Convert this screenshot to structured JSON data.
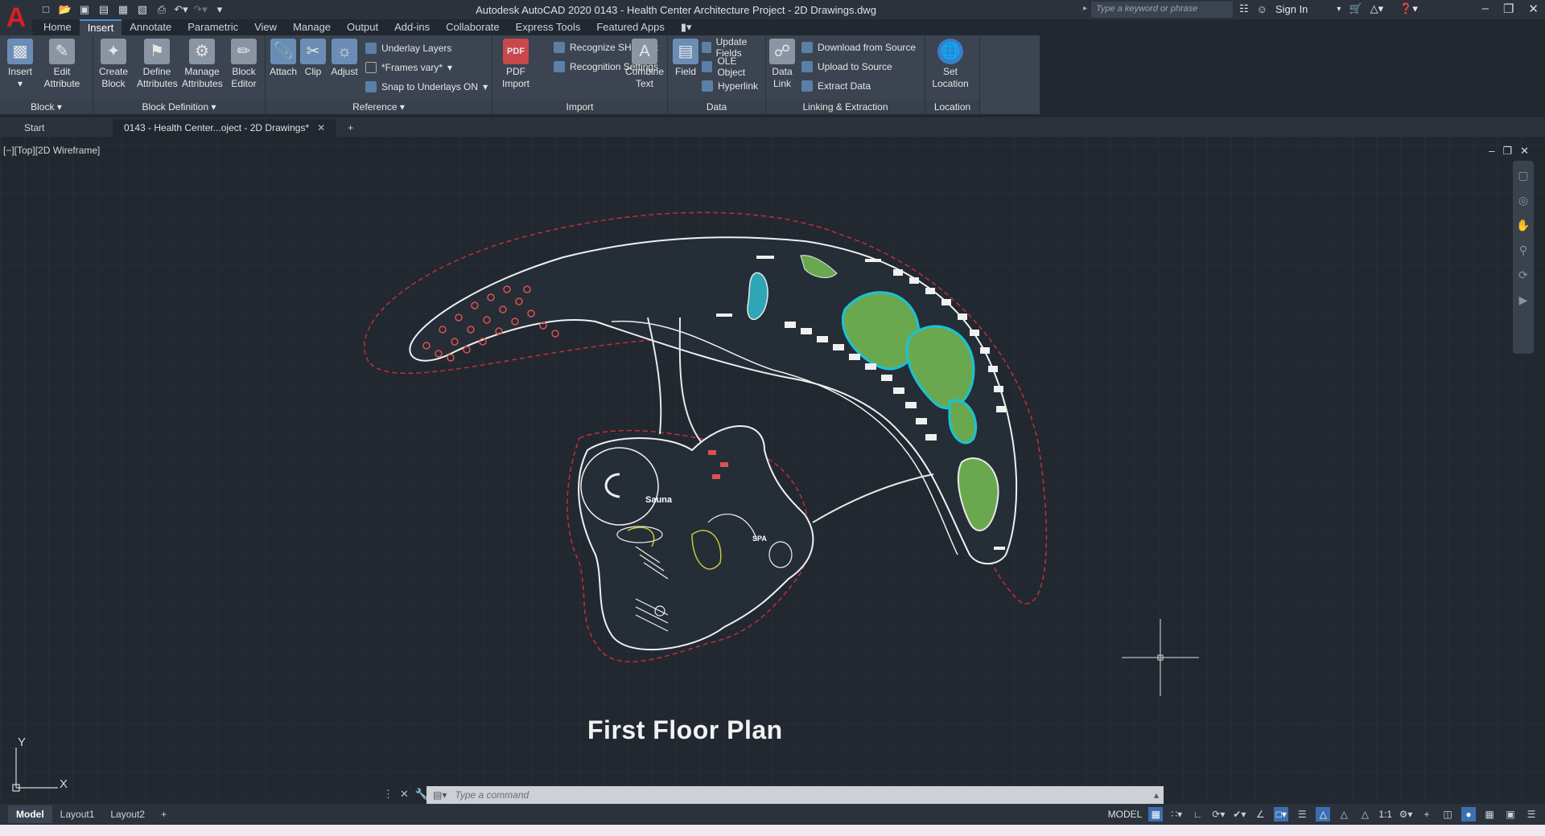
{
  "app": {
    "logo": "A",
    "title": "Autodesk AutoCAD 2020    0143 - Health Center Architecture Project - 2D Drawings.dwg"
  },
  "quick_access": [
    "new-icon",
    "open-icon",
    "save-icon",
    "save-as-icon",
    "web-mobile-open-icon",
    "web-mobile-save-icon",
    "plot-icon",
    "undo-icon",
    "redo-icon",
    "customize-icon"
  ],
  "search": {
    "placeholder": "Type a keyword or phrase"
  },
  "account": {
    "sign_in": "Sign In"
  },
  "ribbon_tabs": [
    "Home",
    "Insert",
    "Annotate",
    "Parametric",
    "View",
    "Manage",
    "Output",
    "Add-ins",
    "Collaborate",
    "Express Tools",
    "Featured Apps"
  ],
  "ribbon_active_tab": "Insert",
  "panels": {
    "block": {
      "title": "Block",
      "insert": "Insert",
      "edit_attribute": "Edit Attribute"
    },
    "block_definition": {
      "title": "Block Definition",
      "create_block": "Create Block",
      "define_attributes": "Define Attributes",
      "manage_attributes": "Manage Attributes",
      "block_editor": "Block Editor"
    },
    "reference": {
      "title": "Reference",
      "attach": "Attach",
      "clip": "Clip",
      "adjust": "Adjust",
      "underlay_layers": "Underlay Layers",
      "frames_vary": "*Frames vary*",
      "snap_to_underlays": "Snap to Underlays ON"
    },
    "import": {
      "title": "Import",
      "pdf_import": "PDF Import",
      "recognize_shx": "Recognize SHX Text",
      "recognition_settings": "Recognition Settings",
      "combine_text": "Combine Text"
    },
    "data": {
      "title": "Data",
      "field": "Field",
      "update_fields": "Update Fields",
      "ole_object": "OLE Object",
      "hyperlink": "Hyperlink"
    },
    "linking": {
      "title": "Linking & Extraction",
      "data_link": "Data Link",
      "download_source": "Download from Source",
      "upload_source": "Upload to Source",
      "extract_data": "Extract  Data"
    },
    "location": {
      "title": "Location",
      "set_location": "Set Location"
    }
  },
  "doc_tabs": [
    "Start",
    "0143 - Health Center...oject - 2D Drawings*"
  ],
  "viewport_label": "[−][Top][2D Wireframe]",
  "drawing": {
    "plan_title": "First Floor Plan",
    "room_labels": [
      "Sauna",
      "SPA"
    ]
  },
  "ucs": {
    "x": "X",
    "y": "Y"
  },
  "command": {
    "placeholder": "Type  a  command"
  },
  "layout_tabs": [
    "Model",
    "Layout1",
    "Layout2"
  ],
  "status": {
    "model": "MODEL",
    "scale": "1:1"
  }
}
